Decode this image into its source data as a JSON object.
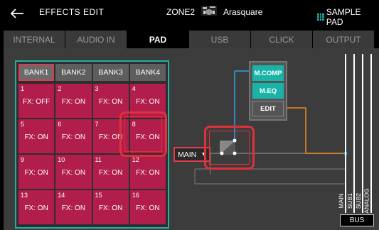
{
  "header": {
    "title": "EFFECTS EDIT",
    "zone": "ZONE2",
    "kit_name": "Arasquare",
    "sample_pad": "SAMPLE PAD"
  },
  "tabs": [
    {
      "label": "INTERNAL",
      "active": false
    },
    {
      "label": "AUDIO IN",
      "active": false
    },
    {
      "label": "PAD",
      "active": true
    },
    {
      "label": "USB",
      "active": false
    },
    {
      "label": "CLICK",
      "active": false
    },
    {
      "label": "OUTPUT",
      "active": false
    }
  ],
  "banks": [
    {
      "label": "BANK1",
      "active": true
    },
    {
      "label": "BANK2",
      "active": false
    },
    {
      "label": "BANK3",
      "active": false
    },
    {
      "label": "BANK4",
      "active": false
    }
  ],
  "pads": [
    {
      "num": "1",
      "fx": "FX: OFF"
    },
    {
      "num": "2",
      "fx": "FX: ON"
    },
    {
      "num": "3",
      "fx": "FX: ON"
    },
    {
      "num": "4",
      "fx": "FX: ON"
    },
    {
      "num": "5",
      "fx": "FX: ON"
    },
    {
      "num": "6",
      "fx": "FX: ON"
    },
    {
      "num": "7",
      "fx": "FX: ON"
    },
    {
      "num": "8",
      "fx": "FX: ON"
    },
    {
      "num": "9",
      "fx": "FX: ON"
    },
    {
      "num": "10",
      "fx": "FX: ON"
    },
    {
      "num": "11",
      "fx": "FX: ON"
    },
    {
      "num": "12",
      "fx": "FX: ON"
    },
    {
      "num": "13",
      "fx": "FX: ON"
    },
    {
      "num": "14",
      "fx": "FX: ON"
    },
    {
      "num": "15",
      "fx": "FX: ON"
    },
    {
      "num": "16",
      "fx": "FX: ON"
    }
  ],
  "routing": {
    "output_select": "MAIN",
    "fx_chain": {
      "mcomp": "M.COMP",
      "meq": "M.EQ",
      "edit": "EDIT"
    }
  },
  "bus": {
    "label": "BUS",
    "channels": [
      "MAIN",
      "SUB1",
      "SUB2",
      "ANALOG"
    ]
  },
  "colors": {
    "accent_teal": "#1ab3a8",
    "pad_red": "#b21e4c",
    "highlight_red": "#e0303c",
    "route_blue": "#2aa3e0",
    "route_orange": "#f08a24"
  }
}
